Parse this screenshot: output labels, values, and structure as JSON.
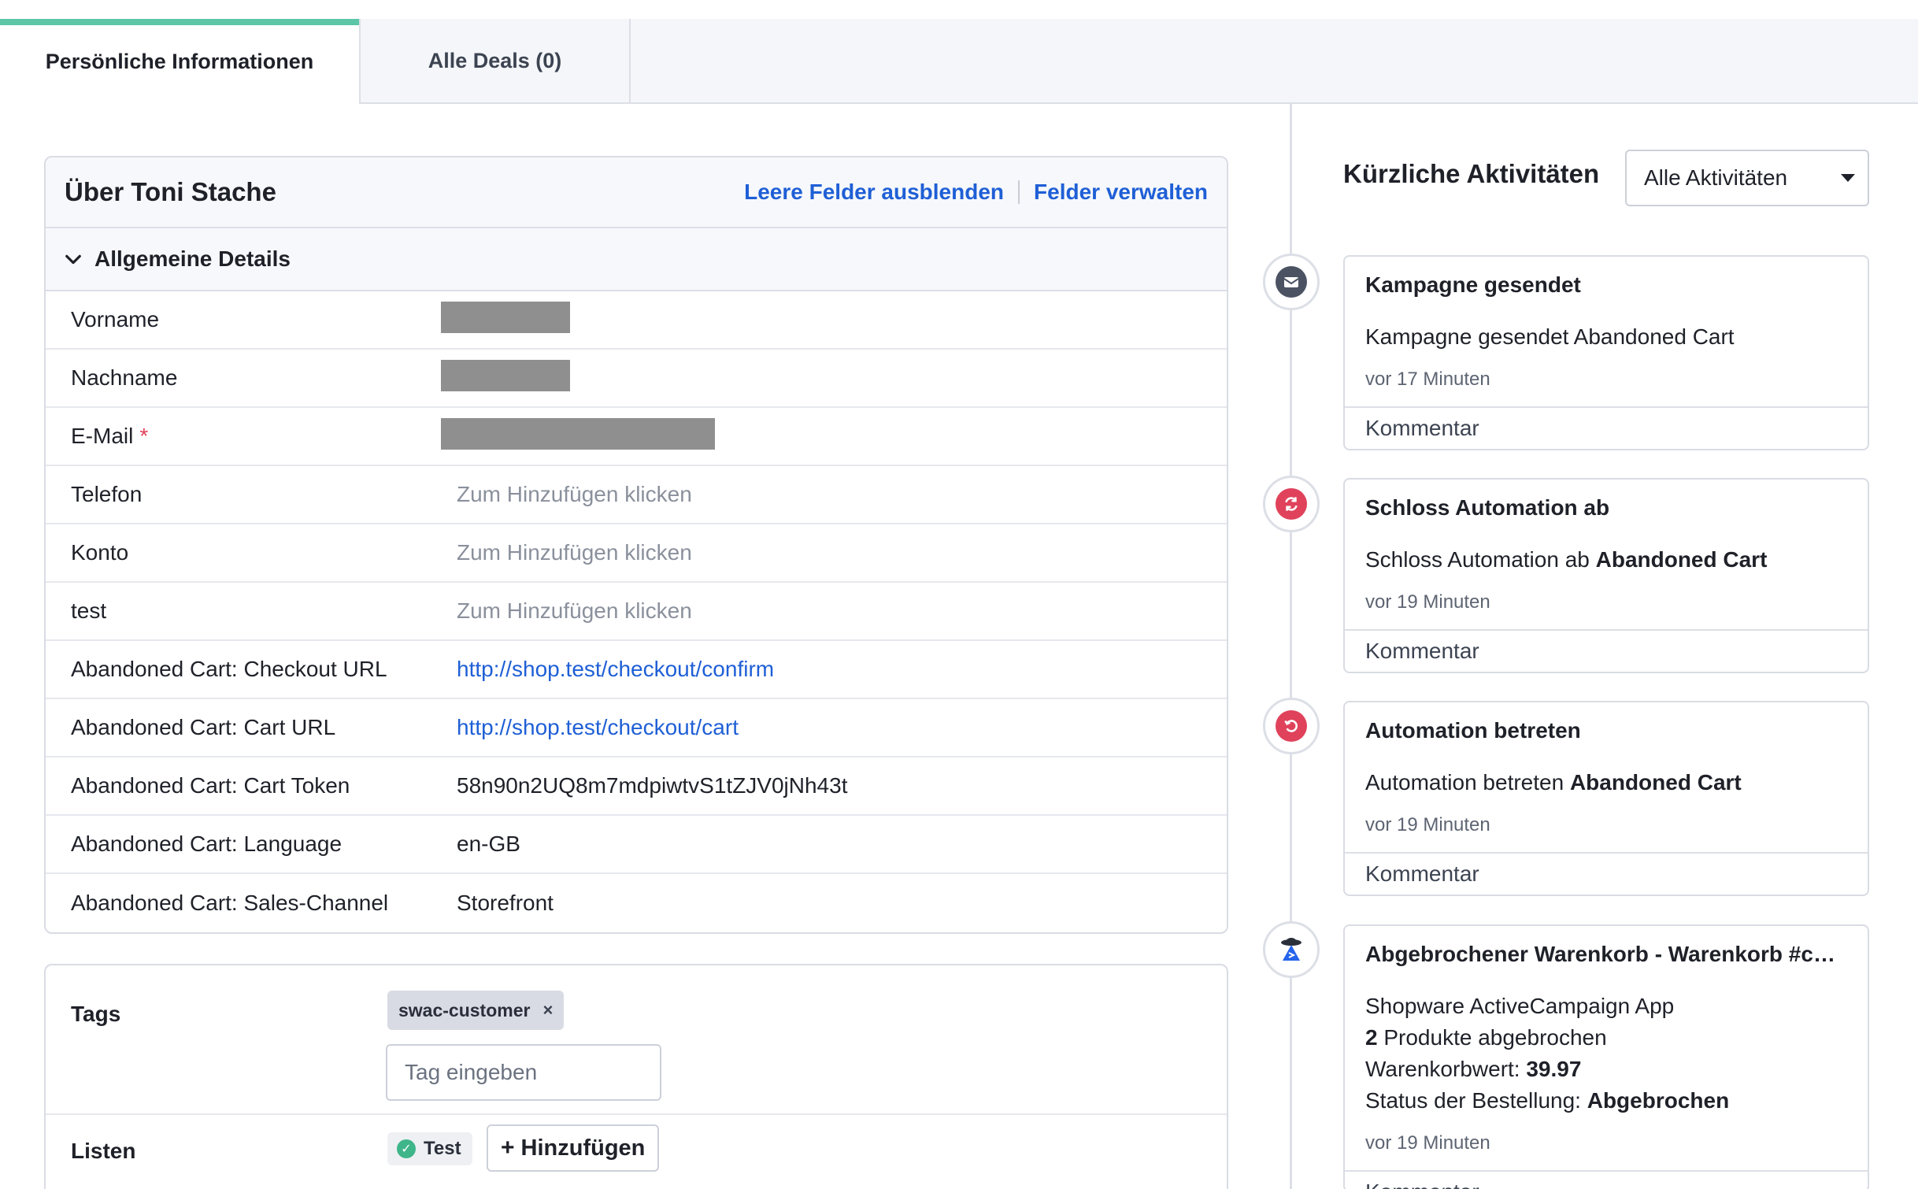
{
  "tabs": {
    "personal": "Persönliche Informationen",
    "deals": "Alle Deals (0)"
  },
  "about": {
    "title": "Über Toni Stache",
    "hide_empty": "Leere Felder ausblenden",
    "manage_fields": "Felder verwalten",
    "section": "Allgemeine Details",
    "fields": [
      {
        "label": "Vorname",
        "value": ""
      },
      {
        "label": "Nachname",
        "value": ""
      },
      {
        "label": "E-Mail",
        "required_mark": "*",
        "value": ""
      },
      {
        "label": "Telefon",
        "value": "Zum Hinzufügen klicken"
      },
      {
        "label": "Konto",
        "value": "Zum Hinzufügen klicken"
      },
      {
        "label": "test",
        "value": "Zum Hinzufügen klicken"
      },
      {
        "label": "Abandoned Cart: Checkout URL",
        "value": "http://shop.test/checkout/confirm"
      },
      {
        "label": "Abandoned Cart: Cart URL",
        "value": "http://shop.test/checkout/cart"
      },
      {
        "label": "Abandoned Cart: Cart Token",
        "value": "58n90n2UQ8m7mdpiwtvS1tZJV0jNh43t"
      },
      {
        "label": "Abandoned Cart: Language",
        "value": "en-GB"
      },
      {
        "label": "Abandoned Cart: Sales-Channel",
        "value": "Storefront"
      }
    ]
  },
  "tags": {
    "label": "Tags",
    "chip": "swac-customer",
    "chip_remove": "×",
    "input_placeholder": "Tag eingeben"
  },
  "lists": {
    "label": "Listen",
    "chip": "Test",
    "add_plus": "+",
    "add_label": "Hinzufügen"
  },
  "activity": {
    "title": "Kürzliche Aktivitäten",
    "filter": "Alle Aktivitäten",
    "comment_label": "Kommentar",
    "items": [
      {
        "icon": "envelope-icon",
        "title": "Kampagne gesendet",
        "desc_plain": "Kampagne gesendet Abandoned Cart",
        "time": "vor 17 Minuten"
      },
      {
        "icon": "automation-exit-icon",
        "title": "Schloss Automation ab",
        "desc_prefix": "Schloss Automation ab",
        "desc_bold": "Abandoned Cart",
        "time": "vor 19 Minuten"
      },
      {
        "icon": "automation-enter-icon",
        "title": "Automation betreten",
        "desc_prefix": "Automation betreten",
        "desc_bold": "Abandoned Cart",
        "time": "vor 19 Minuten"
      },
      {
        "icon": "shopware-app-icon",
        "title": "Abgebrochener Warenkorb - Warenkorb #cart...",
        "line1": "Shopware ActiveCampaign App",
        "line2_bold": "2",
        "line2_rest": "Produkte abgebrochen",
        "line3_label": "Warenkorbwert:",
        "line3_bold": "39.97",
        "line4_label": "Status der Bestellung:",
        "line4_bold": "Abgebrochen",
        "time": "vor 19 Minuten"
      }
    ]
  },
  "colors": {
    "active_tab": "#5cc6a7",
    "link": "#1f5fd6",
    "required": "#e0425b",
    "automation": "#e0425b"
  }
}
